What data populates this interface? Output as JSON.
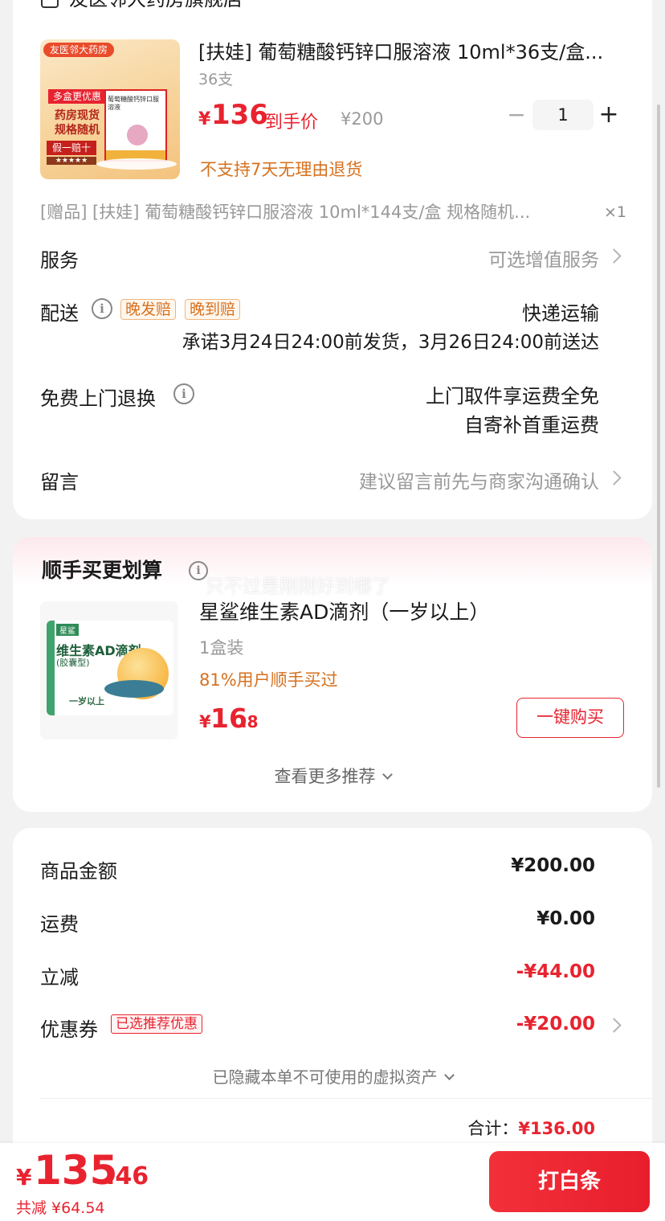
{
  "store": {
    "name": "友医邻大药房旗舰店"
  },
  "product": {
    "title": "[扶娃] 葡萄糖酸钙锌口服溶液 10ml*36支/盒...",
    "spec": "36支",
    "price_symbol": "¥",
    "price": "136",
    "price_label": "到手价",
    "orig_price": "¥200",
    "quantity": "1",
    "return_note": "不支持7天无理由退货",
    "image": {
      "top_banner": "友医邻大药房",
      "badge": "多盒更优惠",
      "lines": [
        "药房现货",
        "规格随机"
      ],
      "fake_guarantee": "假一赔十",
      "stars": "★★★★★",
      "box_text": "葡萄糖酸钙锌口服溶液"
    }
  },
  "gift": {
    "text": "[赠品] [扶娃] 葡萄糖酸钙锌口服溶液 10ml*144支/盒 规格随机...",
    "count": "×1"
  },
  "service": {
    "label": "服务",
    "value": "可选增值服务"
  },
  "delivery": {
    "label": "配送",
    "tags": [
      "晚发赔",
      "晚到赔"
    ],
    "method": "快递运输",
    "promise": "承诺3月24日24:00前发货，3月26日24:00前送达"
  },
  "free_return": {
    "label": "免费上门退换",
    "line1": "上门取件享运费全免",
    "line2": "自寄补首重运费"
  },
  "message": {
    "label": "留言",
    "placeholder": "建议留言前先与商家沟通确认"
  },
  "bundle": {
    "title": "顺手买更划算",
    "overlay_text": "只不过是刚刚好到哪了",
    "item": {
      "title": "星鲨维生素AD滴剂（一岁以上）",
      "spec": "1盒装",
      "stat": "81%用户顺手买过",
      "price_symbol": "¥",
      "price_int": "16",
      "price_dec": ".8",
      "buy_label": "一键购买",
      "image": {
        "brand": "星鲨",
        "name": "维生素AD滴剂",
        "type": "(胶囊型)",
        "age": "一岁以上"
      }
    },
    "more": "查看更多推荐"
  },
  "summary": {
    "rows": [
      {
        "label": "商品金额",
        "value": "¥200.00"
      },
      {
        "label": "运费",
        "value": "¥0.00"
      },
      {
        "label": "立减",
        "value": "-¥44.00"
      },
      {
        "label": "优惠券",
        "tag": "已选推荐优惠",
        "value": "-¥20.00"
      }
    ],
    "hidden_note": "已隐藏本单不可使用的虚拟资产",
    "total_label": "合计：",
    "total": "¥136.00"
  },
  "bottom_bar": {
    "symbol": "¥",
    "price_int": "135",
    "price_dec": ".46",
    "saved": "共减 ¥64.54",
    "pay_label": "打白条"
  },
  "colors": {
    "accent_red": "#e8232f",
    "orange": "#d6711f"
  }
}
